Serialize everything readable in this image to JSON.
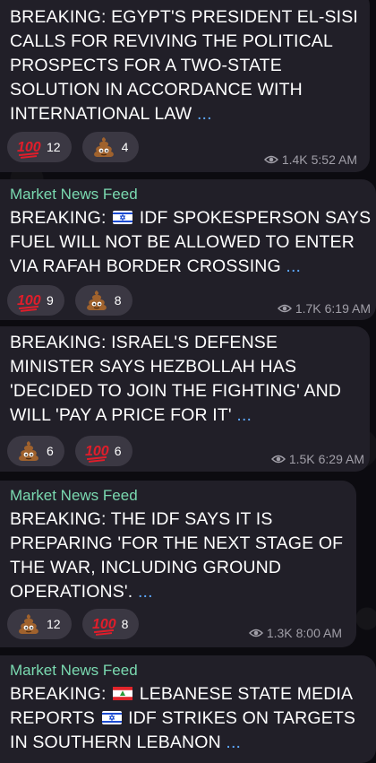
{
  "messages": [
    {
      "sender": "",
      "text": "BREAKING: EGYPT'S PRESIDENT EL-SISI CALLS FOR REVIVING THE POLITICAL PROSPECTS FOR A TWO-STATE SOLUTION IN ACCORDANCE WITH INTERNATIONAL LAW",
      "more": "...",
      "reactions": [
        {
          "emoji": "100",
          "count": "12"
        },
        {
          "emoji": "poop",
          "count": "4"
        }
      ],
      "views": "1.4K",
      "time": "5:52 AM"
    },
    {
      "sender": "Market News Feed",
      "text_pre": "BREAKING:",
      "text_post": "IDF SPOKESPERSON SAYS FUEL WILL NOT BE ALLOWED TO ENTER VIA RAFAH BORDER CROSSING",
      "more": "...",
      "reactions": [
        {
          "emoji": "100",
          "count": "9"
        },
        {
          "emoji": "poop",
          "count": "8"
        }
      ],
      "views": "1.7K",
      "time": "6:19 AM"
    },
    {
      "sender": "",
      "text": "BREAKING: ISRAEL'S DEFENSE MINISTER SAYS HEZBOLLAH HAS 'DECIDED TO JOIN THE FIGHTING' AND WILL 'PAY A PRICE FOR IT'",
      "more": "...",
      "reactions": [
        {
          "emoji": "poop",
          "count": "6"
        },
        {
          "emoji": "100",
          "count": "6"
        }
      ],
      "views": "1.5K",
      "time": "6:29 AM"
    },
    {
      "sender": "Market News Feed",
      "text": "BREAKING: THE IDF SAYS IT IS PREPARING 'FOR THE NEXT STAGE OF THE WAR, INCLUDING GROUND OPERATIONS'.",
      "more": "...",
      "reactions": [
        {
          "emoji": "poop",
          "count": "12"
        },
        {
          "emoji": "100",
          "count": "8"
        }
      ],
      "views": "1.3K",
      "time": "8:00 AM"
    },
    {
      "sender": "Market News Feed",
      "text_pre": "BREAKING:",
      "text_mid": "LEBANESE STATE MEDIA REPORTS",
      "text_post": "IDF STRIKES ON TARGETS IN SOUTHERN LEBANON",
      "more": "..."
    }
  ],
  "colors": {
    "background": "#0c0b10",
    "bubble": "#211f28",
    "sender": "#7ad9b0",
    "link": "#5da8ff",
    "pill": "#3b3843"
  }
}
